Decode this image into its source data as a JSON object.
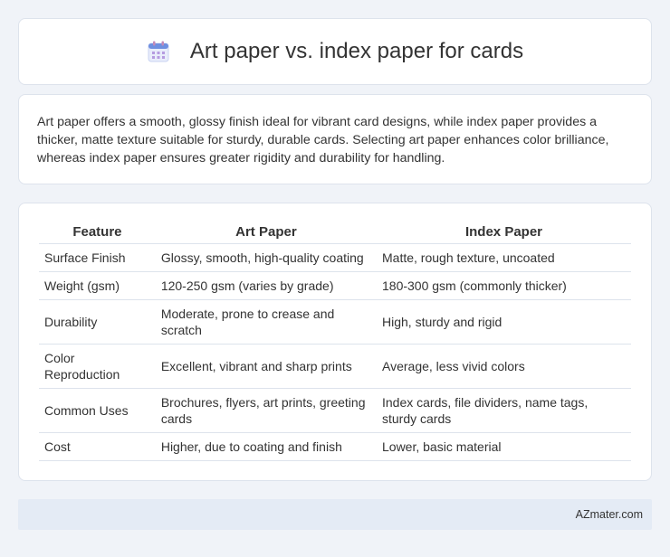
{
  "header": {
    "title": "Art paper vs. index paper for cards",
    "icon": "calendar-icon"
  },
  "intro": {
    "text": "Art paper offers a smooth, glossy finish ideal for vibrant card designs, while index paper provides a thicker, matte texture suitable for sturdy, durable cards. Selecting art paper enhances color brilliance, whereas index paper ensures greater rigidity and durability for handling."
  },
  "table": {
    "headers": [
      "Feature",
      "Art Paper",
      "Index Paper"
    ],
    "rows": [
      [
        "Surface Finish",
        "Glossy, smooth, high-quality coating",
        "Matte, rough texture, uncoated"
      ],
      [
        "Weight (gsm)",
        "120-250 gsm (varies by grade)",
        "180-300 gsm (commonly thicker)"
      ],
      [
        "Durability",
        "Moderate, prone to crease and scratch",
        "High, sturdy and rigid"
      ],
      [
        "Color Reproduction",
        "Excellent, vibrant and sharp prints",
        "Average, less vivid colors"
      ],
      [
        "Common Uses",
        "Brochures, flyers, art prints, greeting cards",
        "Index cards, file dividers, name tags, sturdy cards"
      ],
      [
        "Cost",
        "Higher, due to coating and finish",
        "Lower, basic material"
      ]
    ]
  },
  "footer": {
    "brand": "AZmater.com"
  },
  "colors": {
    "background": "#f0f3f8",
    "card": "#ffffff",
    "footer": "#e4ebf5",
    "icon_accent": "#5b7fd6"
  }
}
